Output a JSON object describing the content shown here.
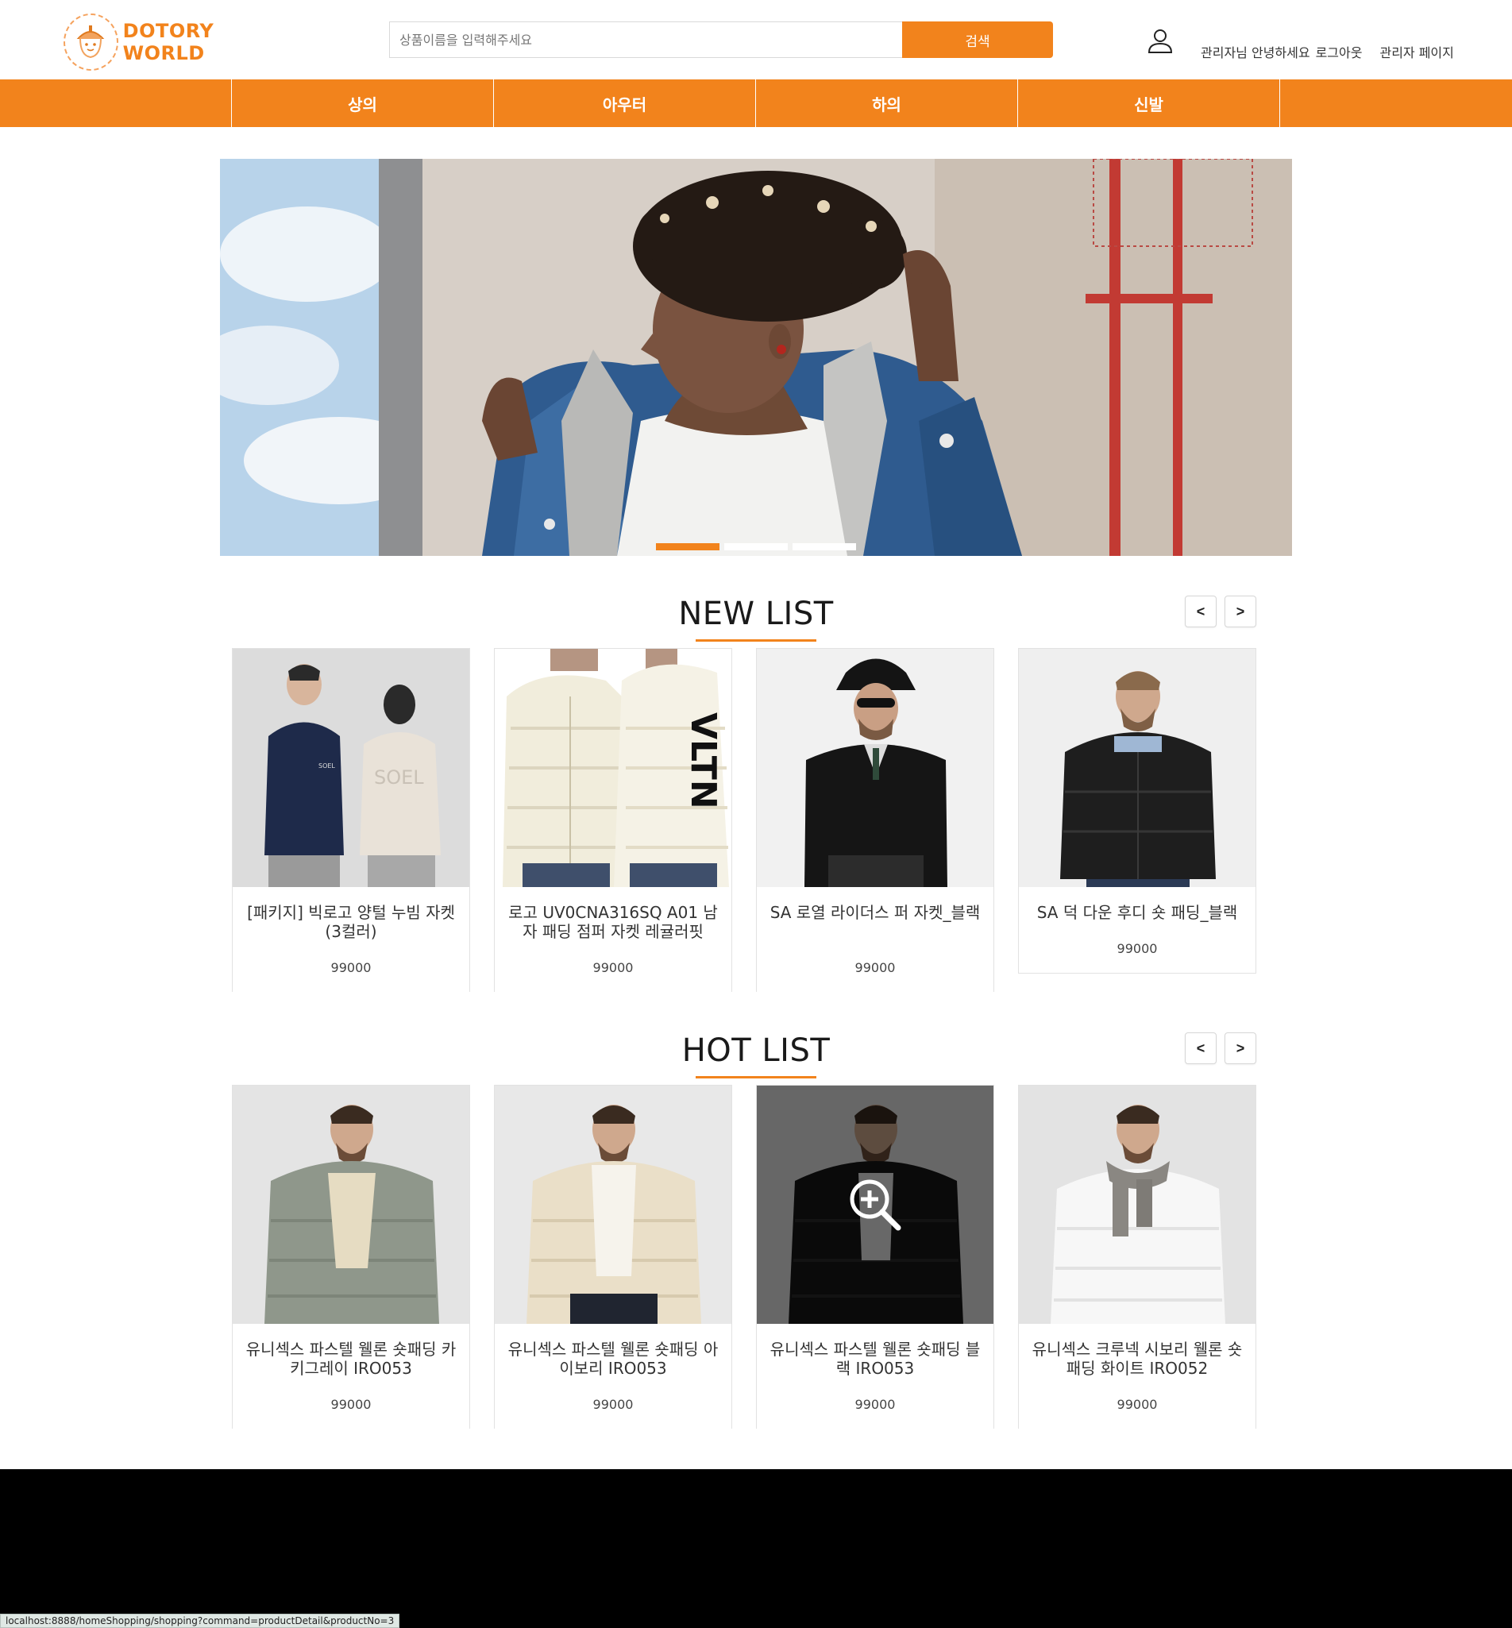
{
  "header": {
    "logo_text": "DOTORY WORLD",
    "search_placeholder": "상품이름을 입력해주세요",
    "search_button": "검색",
    "greeting": "관리자님 안녕하세요",
    "logout": "로그아웃",
    "admin_page": "관리자 페이지"
  },
  "nav": {
    "items": [
      {
        "label": "상의"
      },
      {
        "label": "아우터"
      },
      {
        "label": "하의"
      },
      {
        "label": "신발"
      }
    ]
  },
  "banner": {
    "slide_count": 3,
    "active_slide": 1
  },
  "new_list": {
    "title": "NEW LIST",
    "prev": "<",
    "next": ">",
    "items": [
      {
        "name": "[패키지] 빅로고 양털 누빔 자켓 (3컬러)",
        "price": "99000"
      },
      {
        "name": "로고 UV0CNA316SQ A01 남자 패딩 점퍼 자켓 레귤러핏",
        "price": "99000"
      },
      {
        "name": "SA 로열 라이더스 퍼 자켓_블랙",
        "price": "99000"
      },
      {
        "name": "SA 덕 다운 후디 숏 패딩_블랙",
        "price": "99000"
      }
    ]
  },
  "hot_list": {
    "title": "HOT LIST",
    "prev": "<",
    "next": ">",
    "items": [
      {
        "name": "유니섹스 파스텔 웰론 숏패딩 카키그레이 IRO053",
        "price": "99000"
      },
      {
        "name": "유니섹스 파스텔 웰론 숏패딩 아이보리 IRO053",
        "price": "99000"
      },
      {
        "name": "유니섹스 파스텔 웰론 숏패딩 블랙 IRO053",
        "price": "99000"
      },
      {
        "name": "유니섹스 크루넥 시보리 웰론 숏패딩 화이트 IRO052",
        "price": "99000"
      }
    ]
  },
  "status_bar": {
    "url": "localhost:8888/homeShopping/shopping?command=productDetail&productNo=3"
  },
  "colors": {
    "accent": "#f2831c",
    "footer": "#000000"
  }
}
